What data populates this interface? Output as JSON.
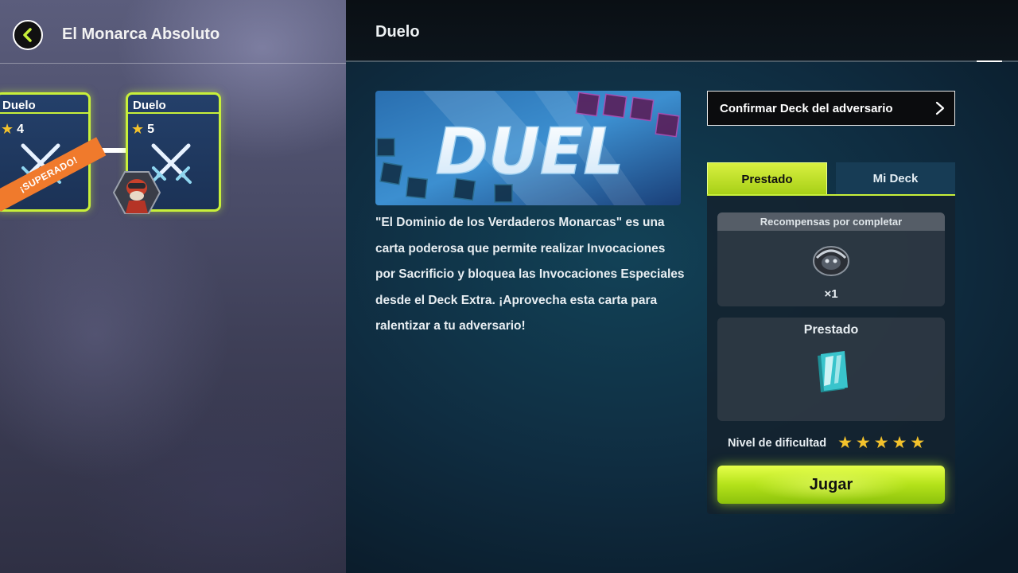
{
  "header": {
    "stage_title": "El Monarca Absoluto",
    "panel_title": "Duelo"
  },
  "stage_map": {
    "nodes": [
      {
        "label": "Duelo",
        "level": "4",
        "status_banner": "¡SUPERADO!"
      },
      {
        "label": "Duelo",
        "level": "5"
      }
    ]
  },
  "duel": {
    "banner_text": "DUEL",
    "description": "\"El Dominio de los Verdaderos Monarcas\" es una carta poderosa que permite realizar Invocaciones por Sacrificio y bloquea las Invocaciones Especiales desde el Deck Extra. ¡Aprovecha esta carta para ralentizar a tu adversario!"
  },
  "side": {
    "confirm_label": "Confirmar Deck del adversario",
    "tabs": [
      {
        "label": "Prestado",
        "active": true
      },
      {
        "label": "Mi Deck",
        "active": false
      }
    ],
    "rewards_title": "Recompensas por completar",
    "reward_quantity": "×1",
    "borrowed_label": "Prestado",
    "difficulty_label": "Nivel de dificultad",
    "difficulty_stars": 5,
    "play_label": "Jugar"
  },
  "colors": {
    "accent": "#c8f03a",
    "star": "#f3c22c",
    "banner": "#f07a2c"
  },
  "icons": [
    "back-arrow-icon",
    "crossed-swords-icon",
    "chevron-right-icon",
    "star-icon",
    "reward-sleeve-icon",
    "deck-icon",
    "duelist-avatar"
  ]
}
